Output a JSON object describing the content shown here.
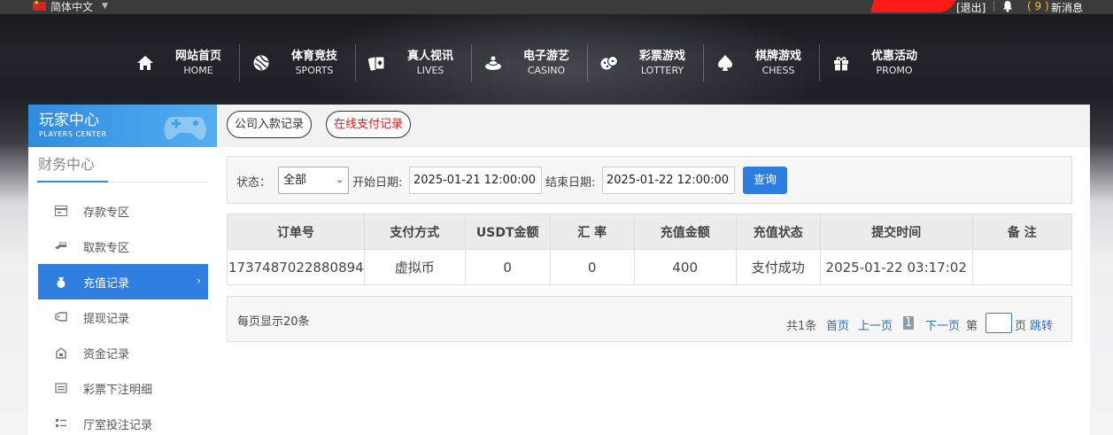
{
  "topbar": {
    "language": "简体中文",
    "logout": "[退出]",
    "message_count": "( 9 )",
    "message_label": "新消息"
  },
  "nav": [
    {
      "cn": "网站首页",
      "en": "HOME",
      "icon": "home-icon"
    },
    {
      "cn": "体育竞技",
      "en": "SPORTS",
      "icon": "ball-icon"
    },
    {
      "cn": "真人视讯",
      "en": "LIVES",
      "icon": "cards-icon"
    },
    {
      "cn": "电子游艺",
      "en": "CASINO",
      "icon": "slot-icon"
    },
    {
      "cn": "彩票游戏",
      "en": "LOTTERY",
      "icon": "dice-icon"
    },
    {
      "cn": "棋牌游戏",
      "en": "CHESS",
      "icon": "spade-icon"
    },
    {
      "cn": "优惠活动",
      "en": "PROMO",
      "icon": "gift-icon"
    }
  ],
  "sidebar": {
    "title": "玩家中心",
    "subtitle": "PLAYERS CENTER",
    "section": "财务中心",
    "items": [
      {
        "label": "存款专区",
        "icon": "deposit-icon"
      },
      {
        "label": "取款专区",
        "icon": "withdraw-icon"
      },
      {
        "label": "充值记录",
        "icon": "recharge-icon",
        "active": true
      },
      {
        "label": "提现记录",
        "icon": "withdraw-record-icon"
      },
      {
        "label": "资金记录",
        "icon": "fund-icon"
      },
      {
        "label": "彩票下注明细",
        "icon": "lottery-bet-icon"
      },
      {
        "label": "厅室投注记录",
        "icon": "hall-bet-icon"
      }
    ]
  },
  "tabs": {
    "company": "公司入款记录",
    "online": "在线支付记录"
  },
  "filter": {
    "status_label": "状态：",
    "status_value": "全部",
    "start_label": "开始日期:",
    "start_value": "2025-01-21 12:00:00",
    "end_label": "结束日期:",
    "end_value": "2025-01-22 12:00:00",
    "query_button": "查询"
  },
  "table": {
    "headers": [
      "订单号",
      "支付方式",
      "USDT金额",
      "汇 率",
      "充值金额",
      "充值状态",
      "提交时间",
      "备 注"
    ],
    "rows": [
      [
        "1737487022880894",
        "虚拟币",
        "0",
        "0",
        "400",
        "支付成功",
        "2025-01-22 03:17:02",
        ""
      ]
    ]
  },
  "pager": {
    "per_page": "每页显示20条",
    "total": "共1条",
    "first": "首页",
    "prev": "上一页",
    "current": "1",
    "next": "下一页",
    "page_prefix": "第",
    "page_suffix": "页",
    "jump": "跳转"
  },
  "colors": {
    "accent": "#2f7ee0",
    "active_tab_text": "#e01b1b",
    "message_count": "#f1c40f"
  }
}
